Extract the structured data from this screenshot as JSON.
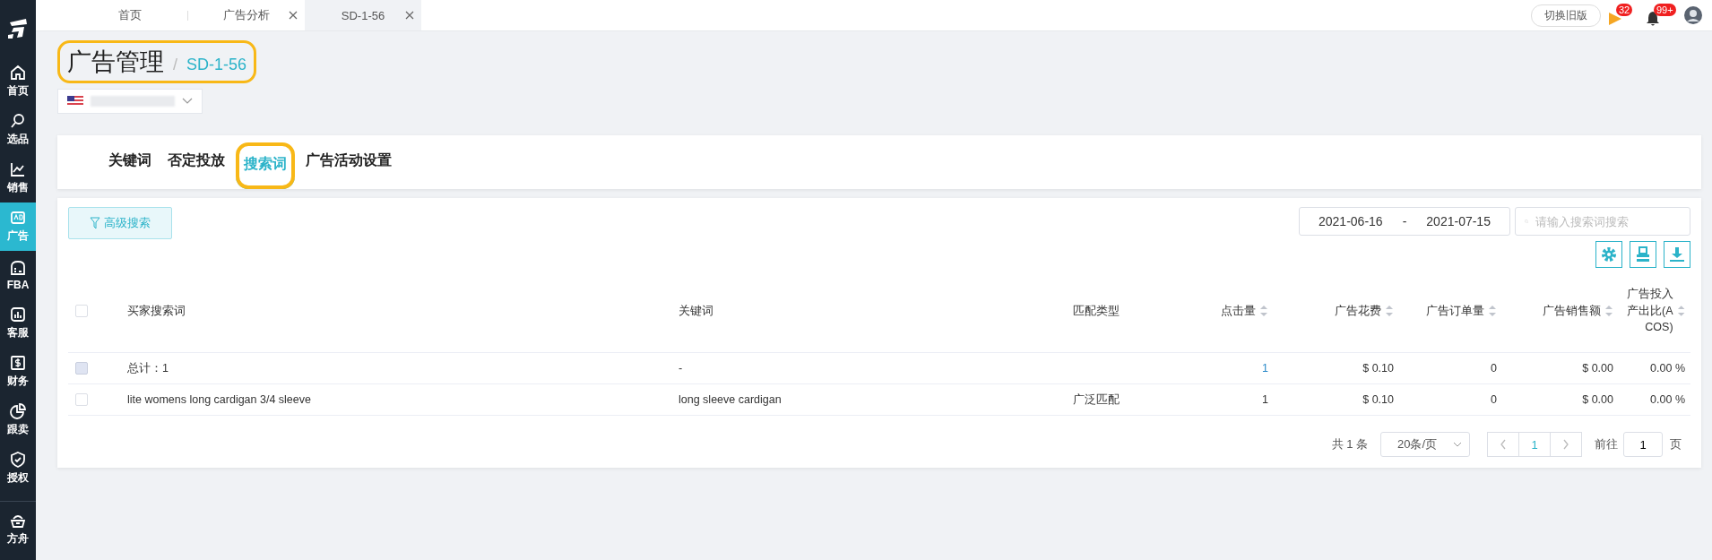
{
  "sidebar": {
    "items": [
      {
        "label": "首页",
        "selected": false
      },
      {
        "label": "选品",
        "selected": false
      },
      {
        "label": "销售",
        "selected": false
      },
      {
        "label": "广告",
        "selected": true
      },
      {
        "label": "FBA",
        "selected": false
      },
      {
        "label": "客服",
        "selected": false
      },
      {
        "label": "财务",
        "selected": false
      },
      {
        "label": "跟卖",
        "selected": false
      },
      {
        "label": "授权",
        "selected": false
      }
    ],
    "bottom_item": {
      "label": "方舟"
    }
  },
  "page_tabs": [
    {
      "label": "首页",
      "selected": false,
      "closable": false
    },
    {
      "label": "广告分析",
      "selected": false,
      "closable": true
    },
    {
      "label": "SD-1-56",
      "selected": true,
      "closable": true
    }
  ],
  "header": {
    "switch_button": "切换旧版",
    "flag_badge": "32",
    "bell_badge": "99+"
  },
  "breadcrumb": {
    "title": "广告管理",
    "separator": "/",
    "current": "SD-1-56"
  },
  "sub_tabs": [
    {
      "label": "关键词",
      "selected": false
    },
    {
      "label": "否定投放",
      "selected": false
    },
    {
      "label": "搜索词",
      "selected": true
    },
    {
      "label": "广告活动设置",
      "selected": false
    }
  ],
  "toolbar": {
    "advanced_search": "高级搜索",
    "date_start": "2021-06-16",
    "date_separator": "-",
    "date_end": "2021-07-15",
    "search": {
      "placeholder": "请输入搜索词搜索"
    }
  },
  "table": {
    "columns": [
      {
        "label": "买家搜索词",
        "sortable": false
      },
      {
        "label": "关键词",
        "sortable": false
      },
      {
        "label": "匹配类型",
        "sortable": false
      },
      {
        "label": "点击量",
        "sortable": true
      },
      {
        "label": "广告花费",
        "sortable": true
      },
      {
        "label": "广告订单量",
        "sortable": true
      },
      {
        "label": "广告销售额",
        "sortable": true
      },
      {
        "label": "广告投入产出比(ACOS)",
        "sortable": true
      }
    ],
    "header_checked": false,
    "rows": [
      {
        "disabled": true,
        "checked": false,
        "cells": [
          "总计：1",
          "-",
          "",
          "1",
          "$ 0.10",
          "0",
          "$ 0.00",
          "0.00 %"
        ]
      },
      {
        "disabled": false,
        "checked": false,
        "cells": [
          "lite womens long cardigan 3/4 sleeve",
          "long sleeve cardigan",
          "广泛匹配",
          "1",
          "$ 0.10",
          "0",
          "$ 0.00",
          "0.00 %"
        ]
      }
    ]
  },
  "pagination": {
    "total": "共 1 条",
    "page_size": "20条/页",
    "current_page": "1",
    "goto_label": "前往",
    "goto_value": "1",
    "page_suffix": "页"
  }
}
